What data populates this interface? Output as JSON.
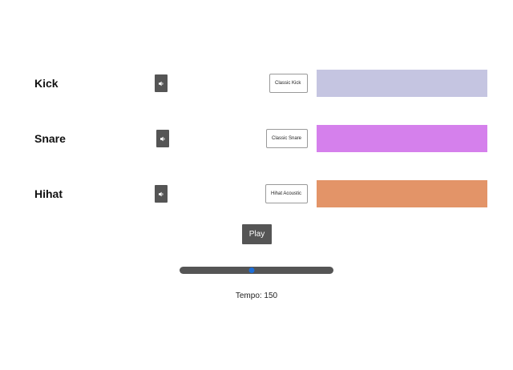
{
  "tracks": [
    {
      "name": "Kick",
      "sound": "Classic Kick",
      "pattern_color": "#c5c5e1"
    },
    {
      "name": "Snare",
      "sound": "Classic Snare",
      "pattern_color": "#d580ec"
    },
    {
      "name": "Hihat",
      "sound": "Hihat Acoustic",
      "pattern_color": "#e39468"
    }
  ],
  "controls": {
    "play_label": "Play",
    "tempo_label": "Tempo: 150",
    "tempo_fraction": 0.47
  },
  "icons": {
    "mute": "speaker-icon",
    "select": "chevron-down-icon"
  },
  "colors": {
    "button": "#555555",
    "slider_thumb": "#1e6fd9"
  }
}
